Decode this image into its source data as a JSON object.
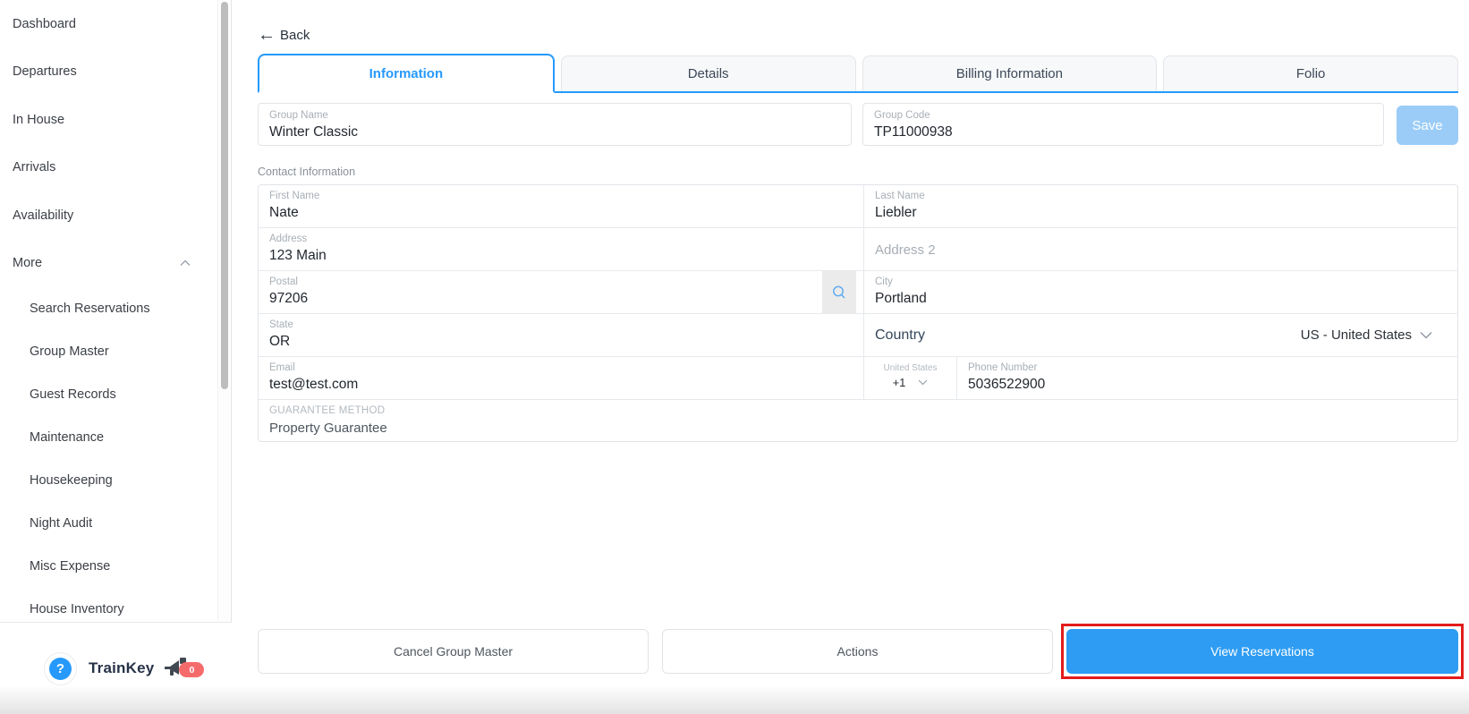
{
  "sidebar": {
    "items": [
      {
        "label": "Dashboard"
      },
      {
        "label": "Departures"
      },
      {
        "label": "In House"
      },
      {
        "label": "Arrivals"
      },
      {
        "label": "Availability"
      },
      {
        "label": "More"
      }
    ],
    "sub_items": [
      {
        "label": "Search Reservations"
      },
      {
        "label": "Group Master"
      },
      {
        "label": "Guest Records"
      },
      {
        "label": "Maintenance"
      },
      {
        "label": "Housekeeping"
      },
      {
        "label": "Night Audit"
      },
      {
        "label": "Misc Expense"
      },
      {
        "label": "House Inventory"
      }
    ],
    "footer": {
      "help_glyph": "?",
      "brand": "TrainKey",
      "notification_count": "0"
    }
  },
  "header": {
    "back_label": "Back"
  },
  "tabs": {
    "items": [
      {
        "label": "Information",
        "active": true
      },
      {
        "label": "Details",
        "active": false
      },
      {
        "label": "Billing Information",
        "active": false
      },
      {
        "label": "Folio",
        "active": false
      }
    ]
  },
  "form": {
    "group_name": {
      "label": "Group Name",
      "value": "Winter Classic"
    },
    "group_code": {
      "label": "Group Code",
      "value": "TP11000938"
    },
    "save_label": "Save",
    "section_title": "Contact Information",
    "first_name": {
      "label": "First Name",
      "value": "Nate"
    },
    "last_name": {
      "label": "Last Name",
      "value": "Liebler"
    },
    "address": {
      "label": "Address",
      "value": "123 Main"
    },
    "address2": {
      "placeholder": "Address 2"
    },
    "postal": {
      "label": "Postal",
      "value": "97206"
    },
    "city": {
      "label": "City",
      "value": "Portland"
    },
    "state": {
      "label": "State",
      "value": "OR"
    },
    "country": {
      "label": "Country",
      "value": "US - United States"
    },
    "phone_country": {
      "label": "United States",
      "value": "+1"
    },
    "phone": {
      "label": "Phone Number",
      "value": "5036522900"
    },
    "guarantee": {
      "label": "GUARANTEE METHOD",
      "value": "Property Guarantee"
    }
  },
  "footer_buttons": {
    "cancel": "Cancel Group Master",
    "actions": "Actions",
    "view": "View Reservations"
  },
  "colors": {
    "accent_blue": "#2699FB",
    "primary_button_blue": "#2D9CF2",
    "disabled_save_blue": "#9BCCF7",
    "highlight_red": "#E31B1B",
    "badge_red": "#F56B6B"
  }
}
